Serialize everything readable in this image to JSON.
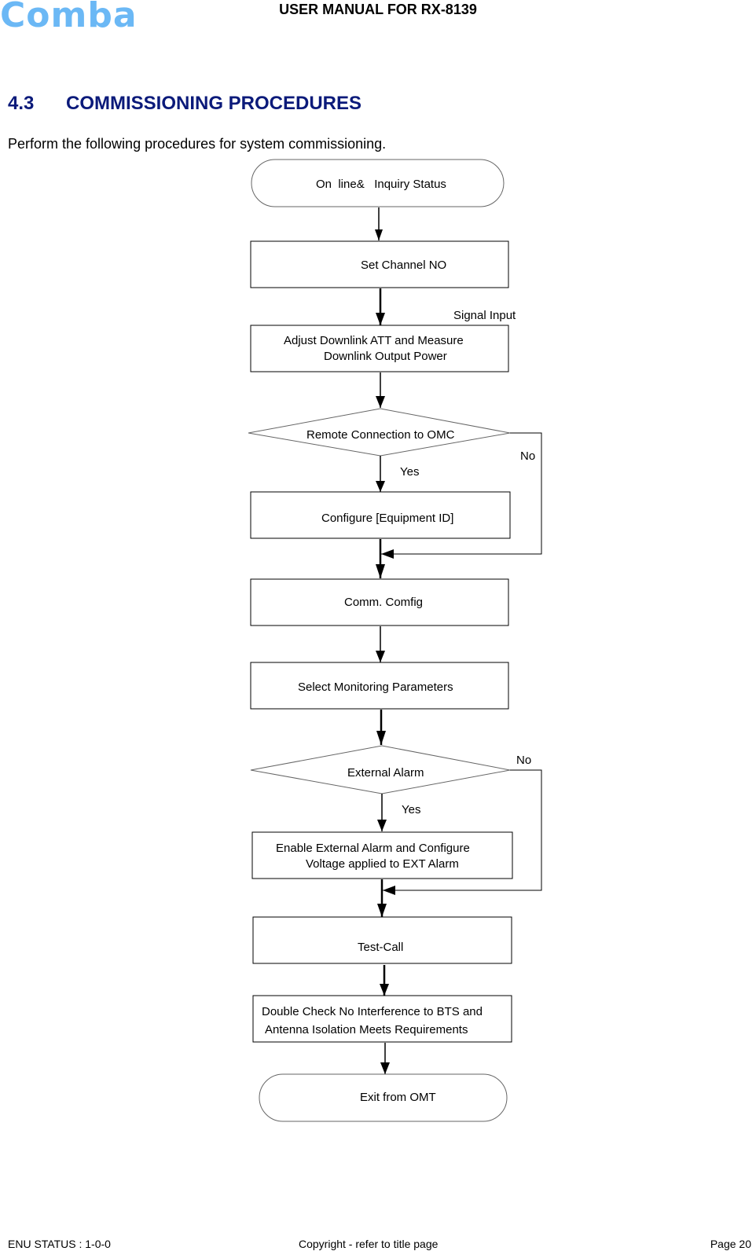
{
  "header": {
    "logo": "Comba",
    "title": "USER MANUAL FOR RX-8139",
    "logo_color": "#6bb8f5"
  },
  "section": {
    "number": "4.3",
    "title": "COMMISSIONING PROCEDURES",
    "intro": "Perform the following procedures for system commissioning.",
    "title_color": "#0b1a7a"
  },
  "flowchart": {
    "start": "On  line&   Inquiry Status",
    "step1": "Set Channel NO",
    "signal_input": "Signal Input",
    "step2_line1": "Adjust Downlink ATT and Measure",
    "step2_line2": "Downlink Output Power",
    "decision1": "Remote Connection to OMC",
    "decision1_yes": "Yes",
    "decision1_no": "No",
    "step3": "Configure [Equipment ID]",
    "step4": "Comm. Comfig",
    "step5": "Select Monitoring Parameters",
    "decision2": "External Alarm",
    "decision2_yes": "Yes",
    "decision2_no": "No",
    "step6_line1": "Enable External Alarm and Configure",
    "step6_line2": "Voltage applied to EXT Alarm",
    "step7": "Test-Call",
    "step8_line1": "Double Check No Interference to BTS and",
    "step8_line2": "Antenna Isolation Meets Requirements",
    "end": "Exit from OMT"
  },
  "footer": {
    "status": "ENU STATUS : 1-0-0",
    "copyright": "Copyright - refer to title page",
    "page": "Page 20"
  }
}
